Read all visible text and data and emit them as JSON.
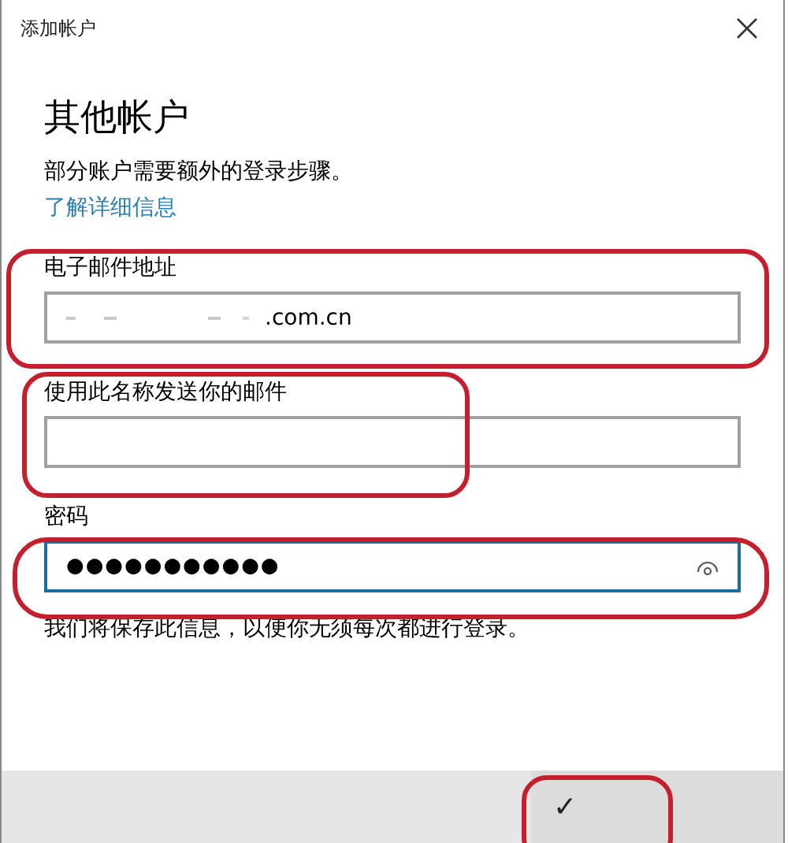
{
  "window": {
    "title": "添加帐户"
  },
  "heading": "其他帐户",
  "description": "部分账户需要额外的登录步骤。",
  "link": "了解详细信息",
  "fields": [
    {
      "kind": "text",
      "label": "电子邮件地址",
      "value": ".com.cn",
      "focused": false
    },
    {
      "kind": "text",
      "label": "使用此名称发送你的邮件",
      "focused": false
    },
    {
      "kind": "password",
      "label": "密码",
      "value": "●●●●●●●●●●●",
      "focused": true
    }
  ],
  "note": "我们将保存此信息，以便你无须每次都进行登录。",
  "footer": {
    "button": "✓"
  }
}
